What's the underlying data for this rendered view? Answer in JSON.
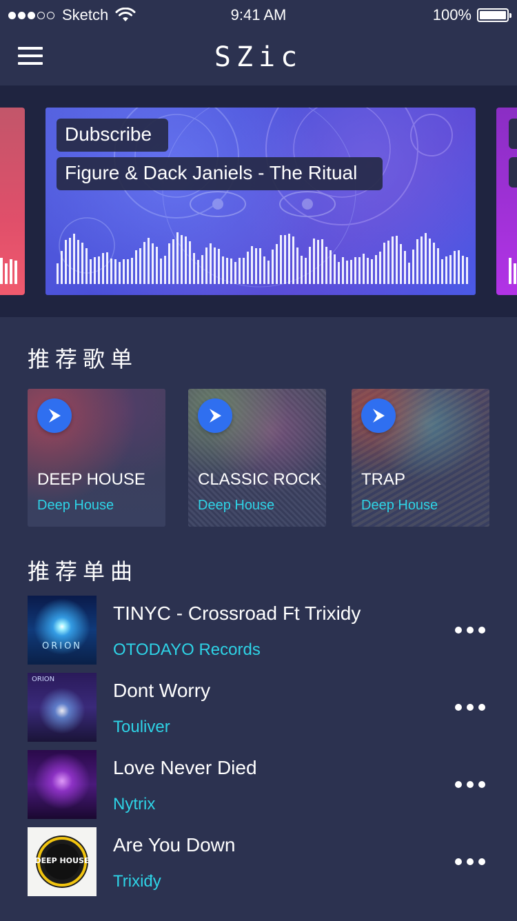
{
  "status_bar": {
    "carrier": "Sketch",
    "time": "9:41 AM",
    "battery": "100%"
  },
  "navbar": {
    "title": "SZic"
  },
  "banner": {
    "subscribe_label": "Dubscribe",
    "track_label": "Figure & Dack Janiels - The Ritual"
  },
  "sections": {
    "playlists_title": "推荐歌单",
    "songs_title": "推荐单曲"
  },
  "playlists": [
    {
      "title": "DEEP HOUSE",
      "subtitle": "Deep House"
    },
    {
      "title": "CLASSIC ROCK",
      "subtitle": "Deep House"
    },
    {
      "title": "TRAP",
      "subtitle": "Deep House"
    }
  ],
  "songs": [
    {
      "title": "TINYC - Crossroad Ft Trixidy",
      "artist": "OTODAYO Records",
      "cover_text": "ORION"
    },
    {
      "title": "Dont Worry",
      "artist": "Touliver",
      "cover_text": "ORION"
    },
    {
      "title": "Love Never Died",
      "artist": "Nytrix",
      "cover_text": ""
    },
    {
      "title": "Are You Down",
      "artist": "Trixiđy",
      "cover_text": "DEEP HOUSE"
    }
  ],
  "colors": {
    "background": "#2c3250",
    "accent_cyan": "#2ed3e6",
    "play_blue": "#2f6ff0"
  }
}
